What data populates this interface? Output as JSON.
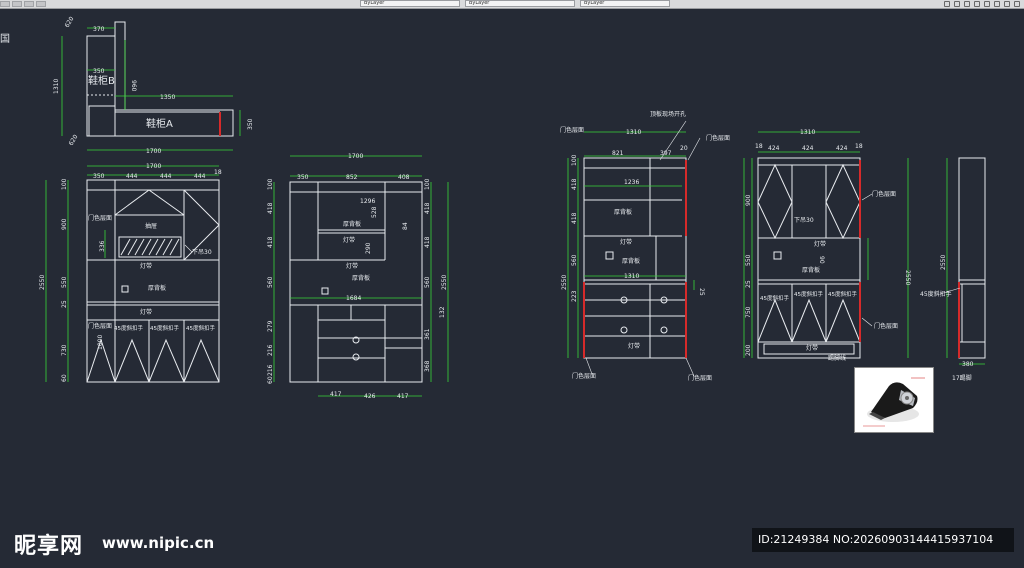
{
  "toolbar": {
    "layer_field_1": "ByLayer",
    "layer_field_2": "ByLayer",
    "layer_field_3": "ByLayer",
    "colors": {
      "background": "#d9dadc"
    }
  },
  "canvas": {
    "corner_label": "国",
    "colors": {
      "background": "#252a35",
      "line": "#e8ebef",
      "dimension": "#38d738",
      "accent": "#d62a2a"
    }
  },
  "plan": {
    "dims": {
      "top_w": "370",
      "w_small": "350",
      "left_h": "1310",
      "mid_h": "960",
      "span": "1350",
      "total_w": "1700",
      "right_h": "350",
      "d1": "620",
      "d2": "620"
    },
    "labels": {
      "cabinet_b": "鞋柜B",
      "cabinet_a": "鞋柜A"
    }
  },
  "elevation_1": {
    "dims": {
      "total_w": "1700",
      "w1": "350",
      "w2": "444",
      "w3": "444",
      "w4": "444",
      "w5": "18",
      "total_h": "2550",
      "h1": "100",
      "h2": "900",
      "h3": "550",
      "h4": "25",
      "h5": "1000",
      "h6": "730",
      "h7": "60",
      "h8": "336",
      "h9": "150"
    },
    "labels": {
      "door": "门色层面",
      "thick": "厚背板",
      "light": "灯带",
      "inner": "抽屉",
      "light2": "灯带",
      "handle1": "45度斜扣手",
      "handle2": "45度斜扣手",
      "handle3": "45度斜扣手",
      "down": "下吊30",
      "num": "888"
    }
  },
  "elevation_2": {
    "dims": {
      "total_w": "1700",
      "w1": "350",
      "w2": "852",
      "w3": "408",
      "total_h": "2550",
      "h1": "100",
      "h2": "418",
      "h3": "418",
      "h4": "560",
      "h5": "1296",
      "h6": "528",
      "h7": "290",
      "h8": "84",
      "w_mid": "1684",
      "bot1": "417",
      "bot2": "426",
      "bot3": "417",
      "h9": "132",
      "h10": "279",
      "h11": "216",
      "h12": "216",
      "h13": "361",
      "h14": "368",
      "h15": "60"
    },
    "labels": {
      "thick": "厚背板",
      "light": "灯带",
      "light2": "灯带",
      "thick2": "厚背板"
    }
  },
  "elevation_3": {
    "dims": {
      "total_w": "1310",
      "w1": "821",
      "w2": "397",
      "w3": "20",
      "total_h": "2550",
      "h1": "100",
      "h2": "418",
      "h3": "418",
      "h4": "560",
      "inner": "1236",
      "mid_w": "1310",
      "h5": "25",
      "h6": "223"
    },
    "labels": {
      "top_note": "顶板现场开孔",
      "door1": "门色层面",
      "door2": "门色层面",
      "thick": "厚背板",
      "light": "灯带",
      "thick2": "厚背板",
      "light2": "灯带",
      "door3": "门色层面",
      "door4": "门色层面"
    }
  },
  "elevation_4": {
    "dims": {
      "total_w": "1310",
      "w0": "18",
      "w1": "424",
      "w2": "424",
      "w3": "424",
      "w4": "18",
      "total_h": "2550",
      "h1": "900",
      "h2": "550",
      "h3": "750",
      "h4": "25",
      "h5": "200",
      "h6": "90"
    },
    "labels": {
      "door1": "门色层面",
      "down": "下吊30",
      "light": "灯带",
      "thick": "厚背板",
      "handle1": "45度斜扣手",
      "handle2": "45度斜扣手",
      "handle3": "45度斜扣手",
      "door2": "门色层面",
      "light2": "灯带",
      "kick": "踢脚线"
    }
  },
  "side_view": {
    "dims": {
      "total_h": "2550",
      "bottom": "380"
    },
    "labels": {
      "handle": "45度斜扣手",
      "foot": "17踢脚"
    }
  },
  "watermark": {
    "brand": "昵享网",
    "url": "www.nipic.cn",
    "id_text": "ID:21249384 NO:20260903144415937104"
  }
}
